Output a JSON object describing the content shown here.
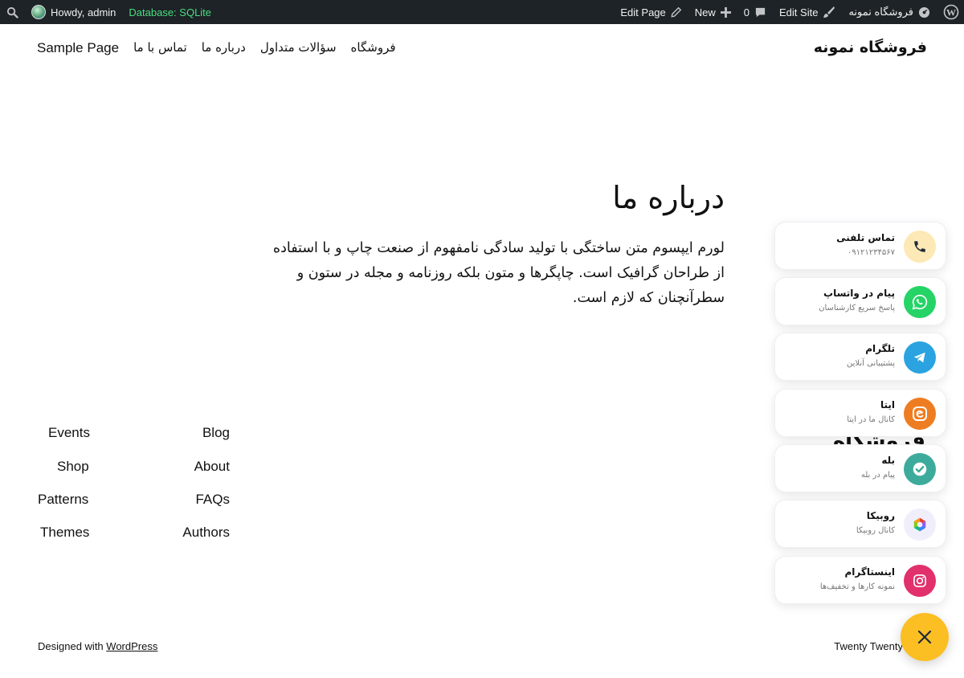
{
  "adminbar": {
    "howdy": "Howdy, admin",
    "database": "Database: SQLite",
    "site_name": "فروشگاه نمونه",
    "edit_site": "Edit Site",
    "comments_count": "0",
    "new_label": "New",
    "edit_page": "Edit Page"
  },
  "header": {
    "site_title": "فروشگاه نمونه",
    "nav": [
      "Sample Page",
      "تماس با ما",
      "درباره ما",
      "سؤالات متداول",
      "فروشگاه"
    ]
  },
  "main": {
    "title": "درباره ما",
    "body": "لورم ایپسوم متن ساختگی با تولید سادگی نامفهوم از صنعت چاپ و با استفاده از طراحان گرافیک است. چاپگرها و متون بلکه روزنامه و مجله در ستون و سطرآنچنان که لازم است."
  },
  "footer": {
    "col1": [
      "Blog",
      "About",
      "FAQs",
      "Authors"
    ],
    "col2": [
      "Events",
      "Shop",
      "Patterns",
      "Themes"
    ],
    "ghost_title": "فروشگاه نمونه",
    "credit_prefix": "Designed with ",
    "credit_link": "WordPress",
    "theme_credit": "Twenty Twenty"
  },
  "widget": {
    "items": [
      {
        "title": "تماس تلفنی",
        "subtitle": "۰۹۱۲۱۲۳۴۵۶۷",
        "icon": "phone-icon",
        "color": "#fde9b6"
      },
      {
        "title": "پیام در واتساپ",
        "subtitle": "پاسخ سریع کارشناسان",
        "icon": "whatsapp-icon",
        "color": "#25d366"
      },
      {
        "title": "تلگرام",
        "subtitle": "پشتیبانی آنلاین",
        "icon": "telegram-icon",
        "color": "#2aa3e0"
      },
      {
        "title": "ایتا",
        "subtitle": "کانال ما در ایتا",
        "icon": "eitaa-icon",
        "color": "#ee7d22"
      },
      {
        "title": "بله",
        "subtitle": "پیام در بله",
        "icon": "bale-icon",
        "color": "#3dab9c"
      },
      {
        "title": "روبیکا",
        "subtitle": "کانال روبیکا",
        "icon": "rubika-icon",
        "color": "#f1eefb"
      },
      {
        "title": "اینستاگرام",
        "subtitle": "نمونه کارها و تخفیف‌ها",
        "icon": "instagram-icon",
        "color": "#e1306c"
      }
    ],
    "fab_color": "#fbbf24"
  }
}
